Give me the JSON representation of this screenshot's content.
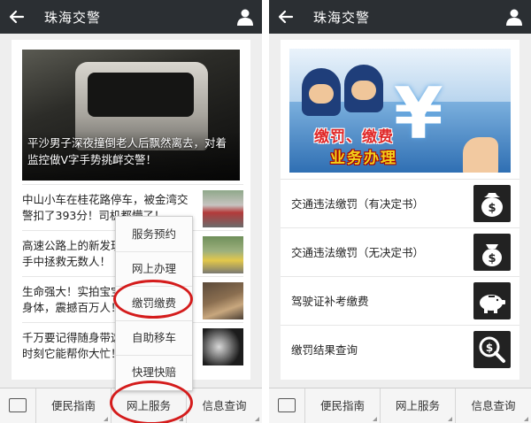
{
  "left": {
    "header": {
      "title": "珠海交警"
    },
    "hero": {
      "caption": "平沙男子深夜撞倒老人后飘然离去，对着监控做V字手势挑衅交警！"
    },
    "news": [
      {
        "title": "中山小车在桂花路停车，被金湾交警扣了393分！司机都懵了！"
      },
      {
        "title": "高速公路上的新发现！交警伸出援手中拯救无数人！"
      },
      {
        "title": "生命强大！实拍宝宝被车辗压后的身体，震撼百万人！"
      },
      {
        "title": "千万要记得随身带这个东西！关键时刻它能帮你大忙！"
      }
    ],
    "popup": {
      "items": [
        "服务预约",
        "网上办理",
        "缴罚缴费",
        "自助移车",
        "快理快赔"
      ]
    },
    "bottom": {
      "tabs": [
        "便民指南",
        "网上服务",
        "信息查询"
      ]
    }
  },
  "right": {
    "header": {
      "title": "珠海交警"
    },
    "banner": {
      "line1": "缴罚、缴费",
      "line2": "业务办理",
      "symbol": "¥"
    },
    "services": [
      {
        "label": "交通违法缴罚（有决定书）",
        "icon": "money-bag-icon"
      },
      {
        "label": "交通违法缴罚（无决定书）",
        "icon": "money-bag-icon"
      },
      {
        "label": "驾驶证补考缴费",
        "icon": "piggy-bank-icon"
      },
      {
        "label": "缴罚结果查询",
        "icon": "magnifier-dollar-icon"
      }
    ],
    "bottom": {
      "tabs": [
        "便民指南",
        "网上服务",
        "信息查询"
      ]
    }
  },
  "colors": {
    "header": "#2b2f33",
    "highlight": "#d41c1c"
  }
}
